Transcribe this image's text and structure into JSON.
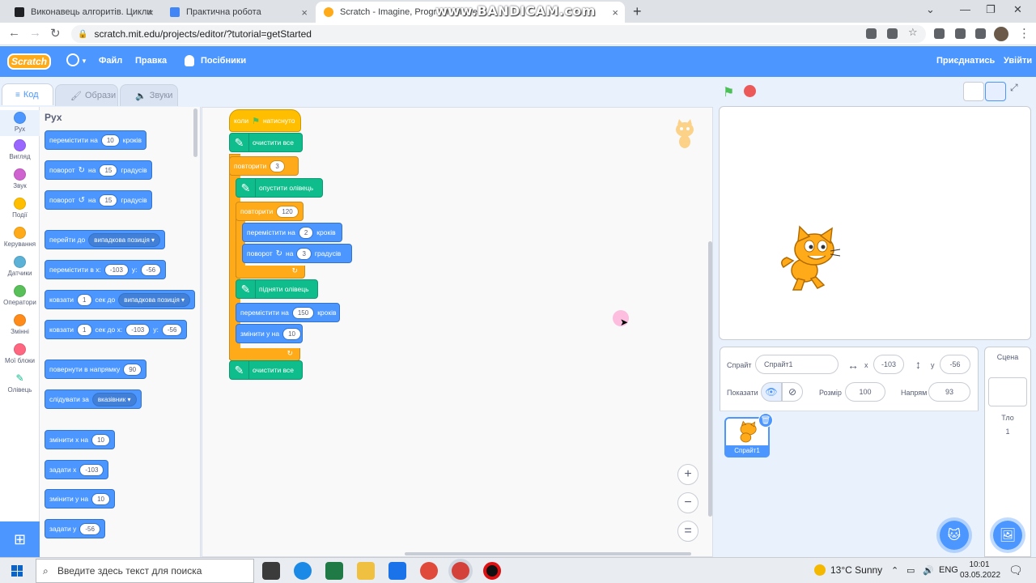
{
  "browser": {
    "tabs": [
      {
        "title": "Виконавець алгоритів. Цикли"
      },
      {
        "title": "Практична робота"
      },
      {
        "title": "Scratch - Imagine, Program, Share"
      }
    ],
    "overlay_watermark": "www.BANDICAM.com",
    "url": "scratch.mit.edu/projects/editor/?tutorial=getStarted"
  },
  "menubar": {
    "logo": "Scratch",
    "file": "Файл",
    "edit": "Правка",
    "tutorials": "Посібники",
    "join": "Приєднатись",
    "signin": "Увійти",
    "colors": {
      "bar": "#4c97ff"
    }
  },
  "editor_tabs": {
    "code": "Код",
    "costumes": "Образи",
    "sounds": "Звуки"
  },
  "categories": [
    {
      "label": "Рух",
      "color": "#4c97ff"
    },
    {
      "label": "Вигляд",
      "color": "#9966ff"
    },
    {
      "label": "Звук",
      "color": "#cf63cf"
    },
    {
      "label": "Події",
      "color": "#ffbf00"
    },
    {
      "label": "Керування",
      "color": "#ffab19"
    },
    {
      "label": "Датчики",
      "color": "#5cb1d6"
    },
    {
      "label": "Оператори",
      "color": "#59c059"
    },
    {
      "label": "Змінні",
      "color": "#ff8c1a"
    },
    {
      "label": "Мої блоки",
      "color": "#ff6680"
    },
    {
      "label": "Олівець",
      "color": "#0fbd8c"
    }
  ],
  "palette": {
    "title": "Рух",
    "move": {
      "a": "перемістити на",
      "v": "10",
      "b": "кроків"
    },
    "turn_right": {
      "a": "поворот",
      "b": "на",
      "v": "15",
      "c": "градусів"
    },
    "turn_left": {
      "a": "поворот",
      "b": "на",
      "v": "15",
      "c": "градусів"
    },
    "goto": {
      "a": "перейти до",
      "dd": "випадкова позиція"
    },
    "goto_xy": {
      "a": "перемістити в x:",
      "x": "-103",
      "b": "y:",
      "y": "-56"
    },
    "glide": {
      "a": "ковзати",
      "v": "1",
      "b": "сек до",
      "dd": "випадкова позиція"
    },
    "glide_xy": {
      "a": "ковзати",
      "v": "1",
      "b": "сек до x:",
      "x": "-103",
      "c": "y:",
      "y": "-56"
    },
    "point_dir": {
      "a": "повернути в напрямку",
      "v": "90"
    },
    "point_towards": {
      "a": "слідувати за",
      "dd": "вказівник"
    },
    "change_x": {
      "a": "змінити х на",
      "v": "10"
    },
    "set_x": {
      "a": "задати х",
      "v": "-103"
    },
    "change_y": {
      "a": "змінити у на",
      "v": "10"
    },
    "set_y": {
      "a": "задати у",
      "v": "-56"
    }
  },
  "script": {
    "hat": {
      "a": "коли",
      "b": "натиснуто"
    },
    "clear1": "очистити все",
    "repeat_outer": {
      "a": "повторити",
      "v": "3"
    },
    "pen_down": "опустити олівець",
    "repeat_inner": {
      "a": "повторити",
      "v": "120"
    },
    "move": {
      "a": "перемістити на",
      "v": "2",
      "b": "кроків"
    },
    "turn": {
      "a": "поворот",
      "b": "на",
      "v": "3",
      "c": "градусів"
    },
    "pen_up": "підняти олівець",
    "move2": {
      "a": "перемістити на",
      "v": "150",
      "b": "кроків"
    },
    "change_y": {
      "a": "змінити у на",
      "v": "10"
    },
    "clear2": "очистити все"
  },
  "sprite_info": {
    "sprite_label": "Спрайт",
    "sprite_name": "Спрайт1",
    "x_label": "x",
    "x": "-103",
    "y_label": "y",
    "y": "-56",
    "show_label": "Показати",
    "size_label": "Розмір",
    "size": "100",
    "direction_label": "Напрям",
    "direction": "93"
  },
  "sprite_list": [
    {
      "name": "Спрайт1"
    }
  ],
  "scene": {
    "header": "Сцена",
    "backdrops_label": "Тло",
    "backdrops_count": "1"
  },
  "taskbar": {
    "search_placeholder": "Введите здесь текст для поиска",
    "weather": "13°C  Sunny",
    "lang": "ENG",
    "time": "10:01",
    "date": "03.05.2022"
  }
}
